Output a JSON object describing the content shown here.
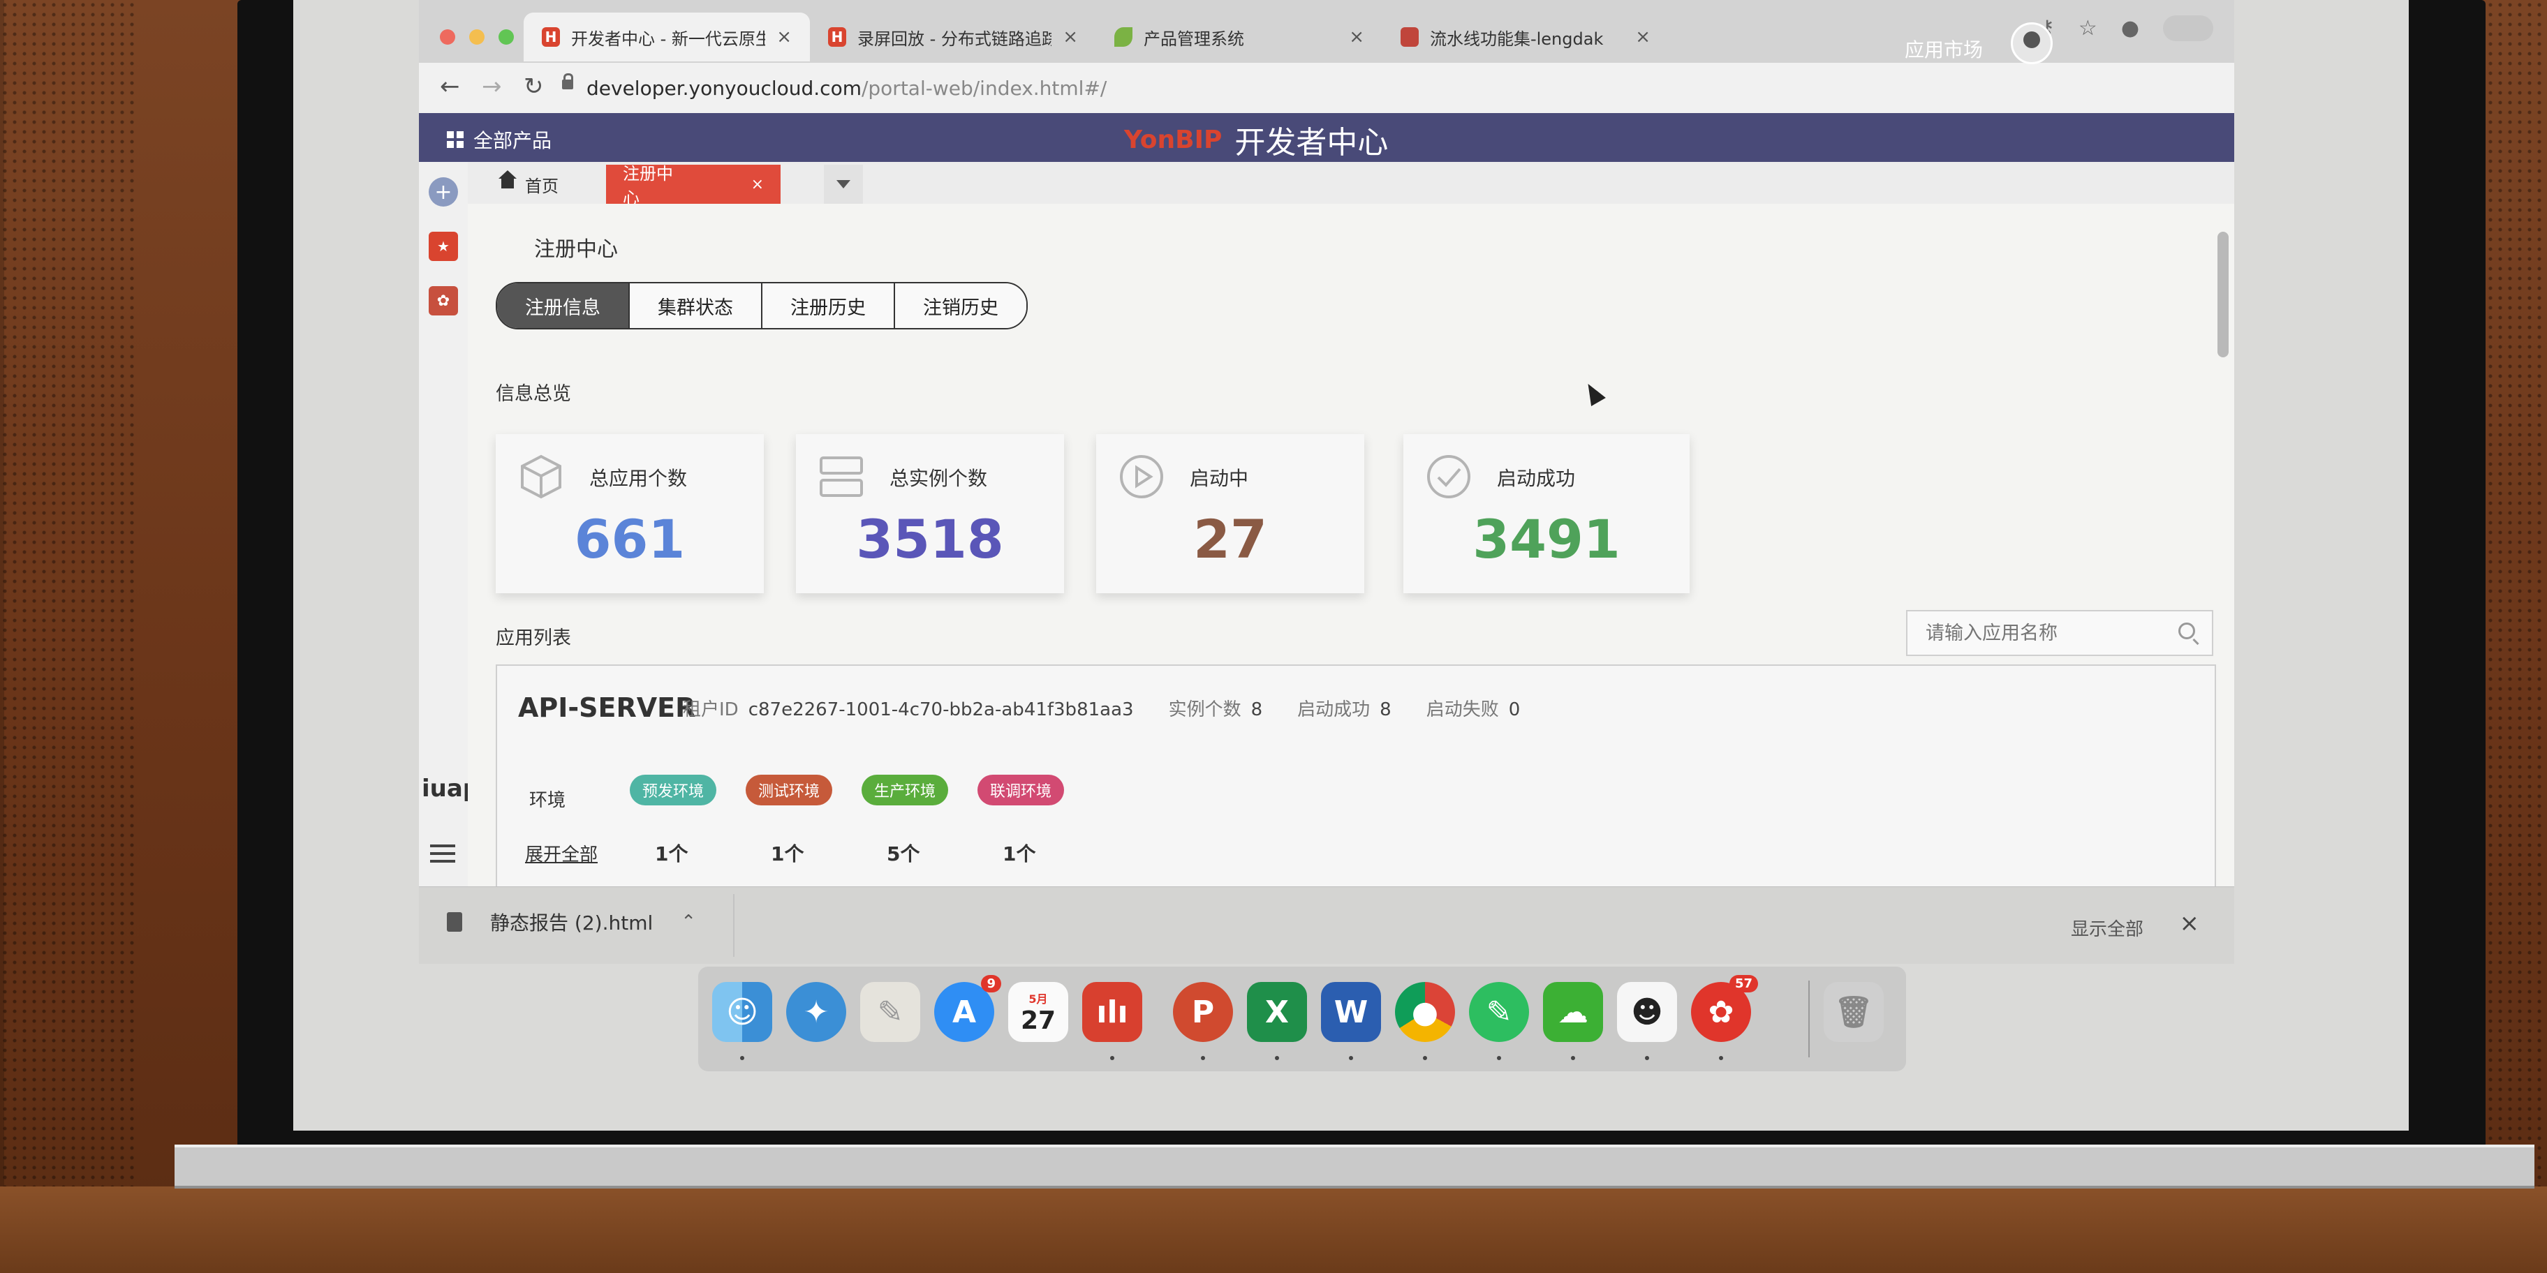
{
  "browser": {
    "tabs": [
      {
        "title": "开发者中心 - 新一代云原生",
        "favicon": "H",
        "color": "#d9442f",
        "active": true
      },
      {
        "title": "录屏回放 - 分布式链路追踪",
        "favicon": "H",
        "color": "#d9442f",
        "active": false
      },
      {
        "title": "产品管理系统",
        "favicon": "leaf-icon",
        "color": "#7bb244",
        "active": false
      },
      {
        "title": "流水线功能集-lengdak",
        "favicon": "app-icon",
        "color": "#c0453b",
        "active": false
      }
    ],
    "url_host": "developer.yonyoucloud.com",
    "url_path": "/portal-web/index.html#/"
  },
  "header": {
    "all_products": "全部产品",
    "brand_logo": "YonBIP",
    "brand_title": "开发者中心",
    "app_market": "应用市场"
  },
  "rail": {
    "logo": "iuap"
  },
  "page_tabs": {
    "home": "首页",
    "active": "注册中心",
    "close": "×"
  },
  "content": {
    "title": "注册中心",
    "segments": [
      "注册信息",
      "集群状态",
      "注册历史",
      "注销历史"
    ],
    "overview_label": "信息总览",
    "stats": [
      {
        "label": "总应用个数",
        "value": "661",
        "color": "#5b84d8"
      },
      {
        "label": "总实例个数",
        "value": "3518",
        "color": "#5a56b8"
      },
      {
        "label": "启动中",
        "value": "27",
        "color": "#8a5a44"
      },
      {
        "label": "启动成功",
        "value": "3491",
        "color": "#4fa25a"
      }
    ],
    "app_list_label": "应用列表",
    "search_placeholder": "请输入应用名称"
  },
  "app": {
    "name": "API-SERVER",
    "tenant_key": "租户ID",
    "tenant_id": "c87e2267-1001-4c70-bb2a-ab41f3b81aa3",
    "instances_key": "实例个数",
    "instances": "8",
    "success_key": "启动成功",
    "success": "8",
    "failed_key": "启动失败",
    "failed": "0",
    "env_label": "环境",
    "envs": [
      {
        "label": "预发环境",
        "count": "1个",
        "color": "#4fb5a4"
      },
      {
        "label": "测试环境",
        "count": "1个",
        "color": "#c65a3a"
      },
      {
        "label": "生产环境",
        "count": "5个",
        "color": "#5aad3c"
      },
      {
        "label": "联调环境",
        "count": "1个",
        "color": "#d24a72"
      }
    ],
    "expand_all": "展开全部"
  },
  "download": {
    "file": "静态报告 (2).html",
    "show_all": "显示全部"
  },
  "dock": {
    "calendar_month": "5月",
    "calendar_day": "27",
    "appstore_badge": "9",
    "app_badge": "57"
  }
}
